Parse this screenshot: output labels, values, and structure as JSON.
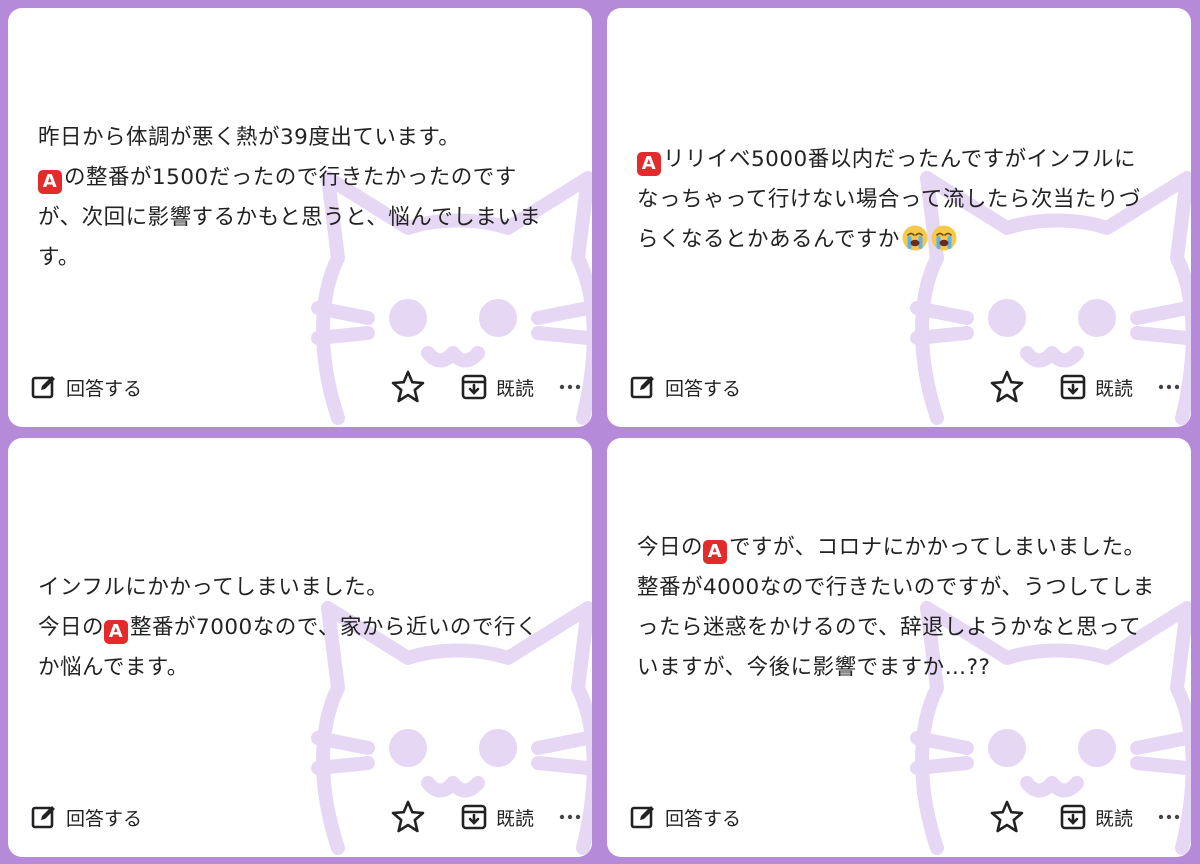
{
  "colors": {
    "background": "#b58ad8",
    "card": "#ffffff",
    "badge": "#e32b2b",
    "cat": "#e4d6f4"
  },
  "cards": [
    {
      "lines": [
        [
          {
            "t": "text",
            "v": "昨日から体調が悪く熱が39度出ています。"
          }
        ],
        [
          {
            "t": "badge",
            "v": "A"
          },
          {
            "t": "text",
            "v": "の整番が1500だったので行きたかったのですが、次回に影響するかもと思うと、悩んでしまいます。"
          }
        ]
      ],
      "answer_label": "回答する",
      "read_label": "既読"
    },
    {
      "lines": [
        [
          {
            "t": "badge",
            "v": "A"
          },
          {
            "t": "text",
            "v": "リリイベ5000番以内だったんですがインフルになっちゃって行けない場合って流したら次当たりづらくなるとかあるんですか"
          },
          {
            "t": "emoji",
            "v": "loudly-crying-face"
          },
          {
            "t": "emoji",
            "v": "loudly-crying-face"
          }
        ]
      ],
      "answer_label": "回答する",
      "read_label": "既読"
    },
    {
      "lines": [
        [
          {
            "t": "text",
            "v": "インフルにかかってしまいました。"
          }
        ],
        [
          {
            "t": "text",
            "v": "今日の"
          },
          {
            "t": "badge",
            "v": "A"
          },
          {
            "t": "text",
            "v": "整番が7000なので、家から近いので行くか悩んでます。"
          }
        ]
      ],
      "answer_label": "回答する",
      "read_label": "既読"
    },
    {
      "lines": [
        [
          {
            "t": "text",
            "v": "今日の"
          },
          {
            "t": "badge",
            "v": "A"
          },
          {
            "t": "text",
            "v": "ですが、コロナにかかってしまいました。"
          }
        ],
        [
          {
            "t": "text",
            "v": "整番が4000なので行きたいのですが、うつしてしまったら迷惑をかけるので、辞退しようかなと思っていますが、今後に影響でますか…??"
          }
        ]
      ],
      "answer_label": "回答する",
      "read_label": "既読"
    }
  ],
  "icons": {
    "answer": "edit-pencil-icon",
    "star": "star-outline-icon",
    "read": "archive-box-icon",
    "more": "more-horizontal-icon",
    "watermark": "cat-face-watermark"
  }
}
